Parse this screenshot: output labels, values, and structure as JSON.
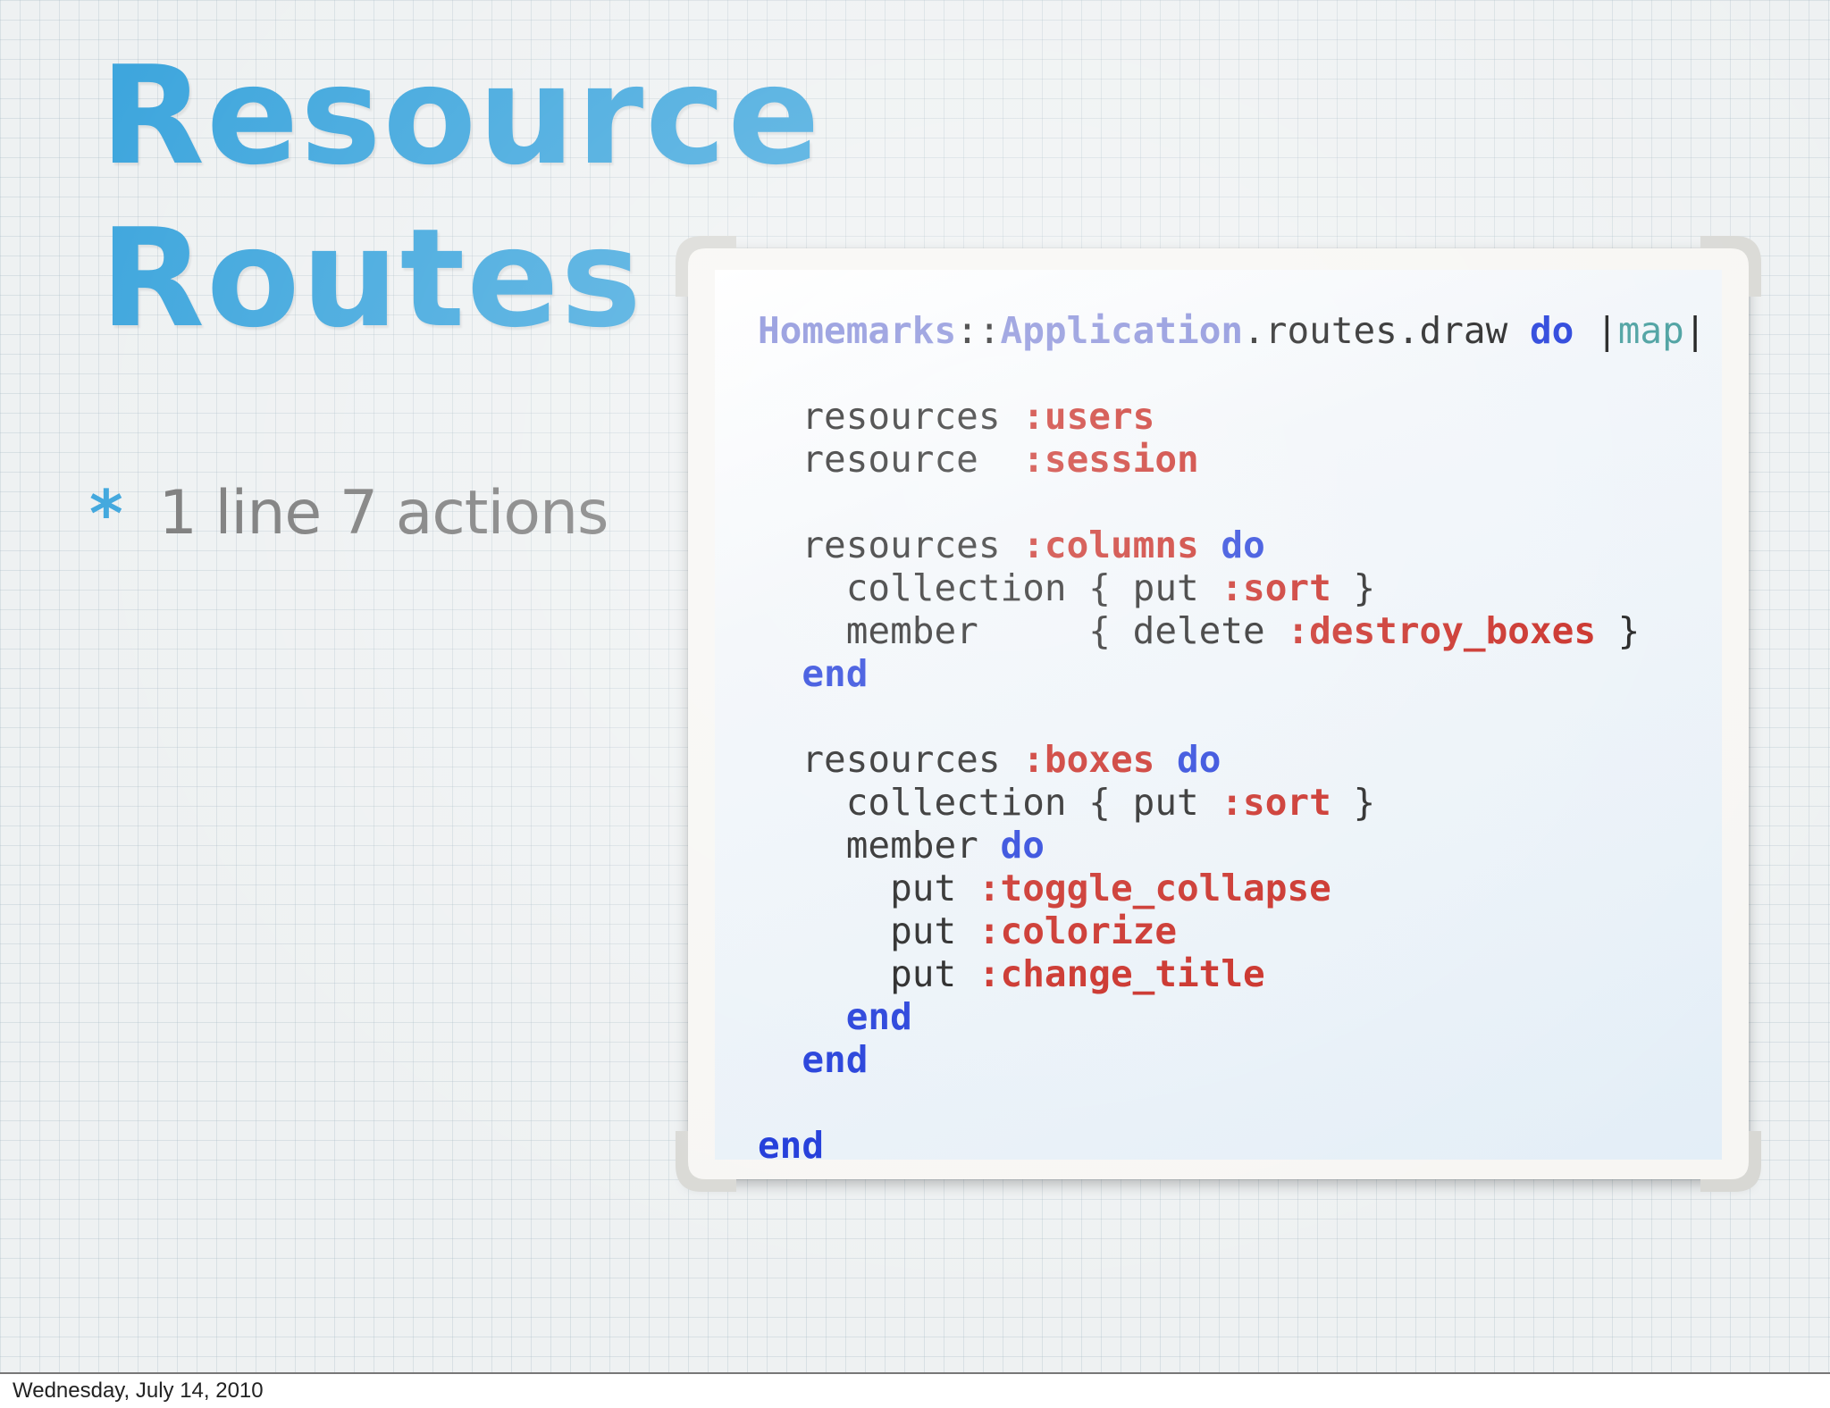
{
  "slide": {
    "title_line_1": "Resource",
    "title_line_2": "Routes",
    "bullet_marker": "*",
    "bullet_text": "1 line 7 actions"
  },
  "code": {
    "lines": [
      [
        {
          "text": "Homemarks",
          "style": "const"
        },
        {
          "text": "::",
          "style": "plain"
        },
        {
          "text": "Application",
          "style": "const"
        },
        {
          "text": ".routes.draw ",
          "style": "plain"
        },
        {
          "text": "do",
          "style": "kw"
        },
        {
          "text": " |",
          "style": "plain"
        },
        {
          "text": "map",
          "style": "param"
        },
        {
          "text": "|",
          "style": "plain"
        }
      ],
      [],
      [
        {
          "text": "  resources ",
          "style": "plain"
        },
        {
          "text": ":users",
          "style": "sym"
        }
      ],
      [
        {
          "text": "  resource  ",
          "style": "plain"
        },
        {
          "text": ":session",
          "style": "sym"
        }
      ],
      [],
      [
        {
          "text": "  resources ",
          "style": "plain"
        },
        {
          "text": ":columns",
          "style": "sym"
        },
        {
          "text": " ",
          "style": "plain"
        },
        {
          "text": "do",
          "style": "kw"
        }
      ],
      [
        {
          "text": "    collection { put ",
          "style": "plain"
        },
        {
          "text": ":sort",
          "style": "sym"
        },
        {
          "text": " }",
          "style": "plain"
        }
      ],
      [
        {
          "text": "    member     { delete ",
          "style": "plain"
        },
        {
          "text": ":destroy_boxes",
          "style": "sym"
        },
        {
          "text": " }",
          "style": "plain"
        }
      ],
      [
        {
          "text": "  ",
          "style": "plain"
        },
        {
          "text": "end",
          "style": "kw"
        }
      ],
      [],
      [
        {
          "text": "  resources ",
          "style": "plain"
        },
        {
          "text": ":boxes",
          "style": "sym"
        },
        {
          "text": " ",
          "style": "plain"
        },
        {
          "text": "do",
          "style": "kw"
        }
      ],
      [
        {
          "text": "    collection { put ",
          "style": "plain"
        },
        {
          "text": ":sort",
          "style": "sym"
        },
        {
          "text": " }",
          "style": "plain"
        }
      ],
      [
        {
          "text": "    member ",
          "style": "plain"
        },
        {
          "text": "do",
          "style": "kw"
        }
      ],
      [
        {
          "text": "      put ",
          "style": "plain"
        },
        {
          "text": ":toggle_collapse",
          "style": "sym"
        }
      ],
      [
        {
          "text": "      put ",
          "style": "plain"
        },
        {
          "text": ":colorize",
          "style": "sym"
        }
      ],
      [
        {
          "text": "      put ",
          "style": "plain"
        },
        {
          "text": ":change_title",
          "style": "sym"
        }
      ],
      [
        {
          "text": "    ",
          "style": "plain"
        },
        {
          "text": "end",
          "style": "kw"
        }
      ],
      [
        {
          "text": "  ",
          "style": "plain"
        },
        {
          "text": "end",
          "style": "kw"
        }
      ],
      [],
      [
        {
          "text": "end",
          "style": "kw"
        }
      ]
    ]
  },
  "footer": {
    "date": "Wednesday, July 14, 2010"
  },
  "colors": {
    "title": "#3ea6dd",
    "bullet_text": "#7a7a7a",
    "keyword": "#1532d8",
    "symbol": "#c51c14",
    "constant": "#7e86d7",
    "block_param": "#3f9a9a"
  }
}
